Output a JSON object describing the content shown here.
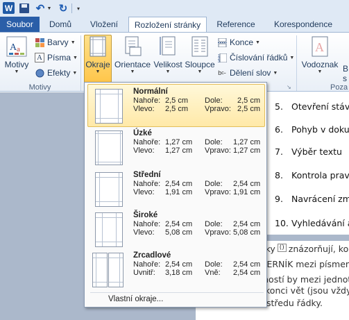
{
  "qat": {
    "word_logo": "W"
  },
  "tabs": {
    "file": "Soubor",
    "home": "Domů",
    "insert": "Vložení",
    "layout": "Rozložení stránky",
    "references": "Reference",
    "mailings": "Korespondence"
  },
  "ribbon": {
    "themes": {
      "themes_label": "Motivy",
      "colors": "Barvy",
      "fonts": "Písma",
      "effects": "Efekty",
      "group_label": "Motivy"
    },
    "page_setup": {
      "margins": "Okraje",
      "orientation": "Orientace",
      "size": "Velikost",
      "columns": "Sloupce",
      "breaks": "Konce",
      "line_numbers": "Číslování řádků",
      "hyphenation": "Dělení slov"
    },
    "page_background": {
      "watermark": "Vodoznak",
      "truncated": "B",
      "truncated2": "s",
      "group_label_partial": "Poza"
    }
  },
  "dropdown": {
    "options": [
      {
        "name": "Normální",
        "top_label": "Nahoře:",
        "top": "2,5 cm",
        "bottom_label": "Dole:",
        "bottom": "2,5 cm",
        "left_label": "Vlevo:",
        "left": "2,5 cm",
        "right_label": "Vpravo:",
        "right": "2,5 cm"
      },
      {
        "name": "Úzké",
        "top_label": "Nahoře:",
        "top": "1,27 cm",
        "bottom_label": "Dole:",
        "bottom": "1,27 cm",
        "left_label": "Vlevo:",
        "left": "1,27 cm",
        "right_label": "Vpravo:",
        "right": "1,27 cm"
      },
      {
        "name": "Střední",
        "top_label": "Nahoře:",
        "top": "2,54 cm",
        "bottom_label": "Dole:",
        "bottom": "2,54 cm",
        "left_label": "Vlevo:",
        "left": "1,91 cm",
        "right_label": "Vpravo:",
        "right": "1,91 cm"
      },
      {
        "name": "Široké",
        "top_label": "Nahoře:",
        "top": "2,54 cm",
        "bottom_label": "Dole:",
        "bottom": "2,54 cm",
        "left_label": "Vlevo:",
        "left": "5,08 cm",
        "right_label": "Vpravo:",
        "right": "5,08 cm"
      },
      {
        "name": "Zrcadlové",
        "top_label": "Nahoře:",
        "top": "2,54 cm",
        "bottom_label": "Dole:",
        "bottom": "2,54 cm",
        "left_label": "Uvnitř:",
        "left": "3,18 cm",
        "right_label": "Vně:",
        "right": "2,54 cm"
      }
    ],
    "custom": "Vlastní okraje..."
  },
  "document": {
    "list": [
      {
        "num": "5.",
        "text": "Otevření stáv"
      },
      {
        "num": "6.",
        "text": "Pohyb v doku"
      },
      {
        "num": "7.",
        "text": "Výběr textu"
      },
      {
        "num": "8.",
        "text": "Kontrola prav"
      },
      {
        "num": "9.",
        "text": "Navrácení zm"
      },
      {
        "num": "10.",
        "text": "Vyhledávání a"
      }
    ],
    "page2_lines": [
      "ečky",
      "znázorňují, ko",
      "EZERNÍK mezi písmen",
      "olností by mezi jednot",
      "konci vět (jsou vždy z",
      "středu řádky."
    ],
    "paren": "()"
  }
}
